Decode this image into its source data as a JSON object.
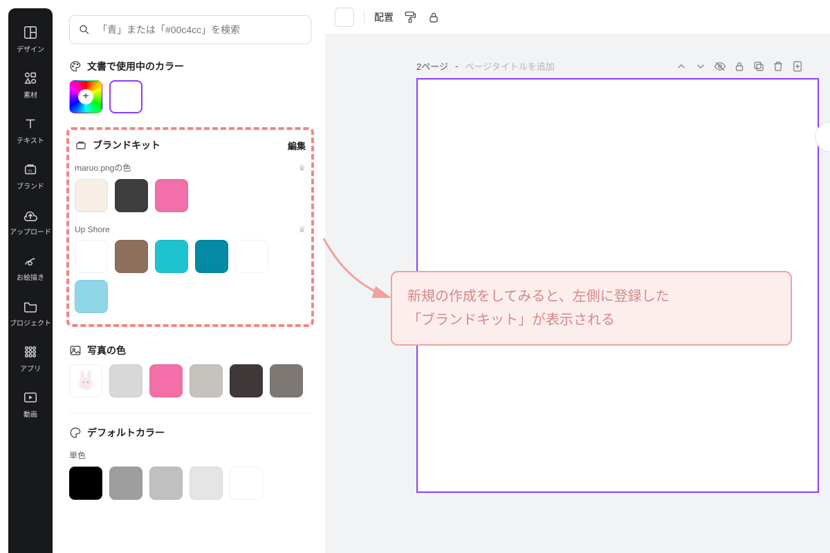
{
  "sidebar": {
    "items": [
      {
        "label": "デザイン",
        "icon": "layout-icon"
      },
      {
        "label": "素材",
        "icon": "shapes-icon"
      },
      {
        "label": "テキスト",
        "icon": "text-icon"
      },
      {
        "label": "ブランド",
        "icon": "brand-icon"
      },
      {
        "label": "アップロード",
        "icon": "upload-icon"
      },
      {
        "label": "お絵描き",
        "icon": "draw-icon"
      },
      {
        "label": "プロジェクト",
        "icon": "folder-icon"
      },
      {
        "label": "アプリ",
        "icon": "grid-icon"
      },
      {
        "label": "動画",
        "icon": "video-icon"
      }
    ]
  },
  "search": {
    "placeholder": "「青」または「#00c4cc」を検索"
  },
  "sections": {
    "doc_colors": {
      "title": "文書で使用中のカラー"
    },
    "brandkit": {
      "title": "ブランドキット",
      "edit": "編集",
      "palettes": [
        {
          "name": "maruo.pngの色",
          "colors": [
            "#f7eee5",
            "#3d3d3d",
            "#f26fa9"
          ]
        },
        {
          "name": "Up Shore",
          "colors": [
            "#ffffff",
            "#8d6f5b",
            "#1ec3d0",
            "#048aa3",
            "#ffffff",
            "#8fd7e8"
          ]
        }
      ]
    },
    "photo_colors": {
      "title": "写真の色",
      "colors": [
        "#d8d8d8",
        "#f26fa9",
        "#c6c3be",
        "#403738",
        "#7e7875"
      ]
    },
    "default_colors": {
      "title": "デフォルトカラー",
      "sub": "単色",
      "colors": [
        "#000000",
        "#9e9e9e",
        "#c0c0c0",
        "#e5e5e5",
        "#ffffff"
      ]
    }
  },
  "topbar": {
    "position": "配置"
  },
  "page": {
    "number": "2ページ",
    "title_hint": "ページタイトルを追加"
  },
  "annotation": {
    "line1": "新規の作成をしてみると、左側に登録した",
    "line2": "「ブランドキット」が表示される"
  }
}
